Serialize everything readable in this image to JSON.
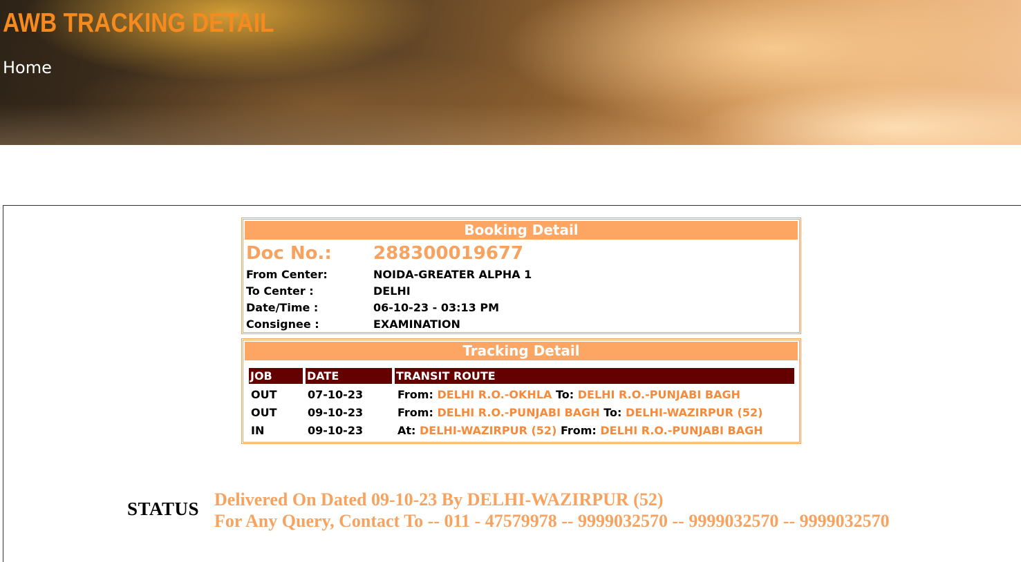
{
  "banner": {
    "title": "AWB TRACKING DETAIL",
    "breadcrumb": "Home"
  },
  "booking": {
    "header": "Booking Detail",
    "doc_label": "Doc No.:",
    "doc_value": "288300019677",
    "rows": [
      {
        "label": "From Center:",
        "value": "NOIDA-GREATER ALPHA 1"
      },
      {
        "label": "To Center :",
        "value": "DELHI"
      },
      {
        "label": "Date/Time :",
        "value": "06-10-23 - 03:13 PM"
      },
      {
        "label": "Consignee :",
        "value": "EXAMINATION"
      }
    ]
  },
  "tracking": {
    "header": "Tracking Detail",
    "columns": [
      "JOB",
      "DATE",
      "TRANSIT ROUTE"
    ],
    "rows": [
      {
        "job": "OUT",
        "date": "07-10-23",
        "kw1": "From:",
        "loc1": "DELHI R.O.-OKHLA",
        "kw2": "To:",
        "loc2": "DELHI R.O.-PUNJABI BAGH"
      },
      {
        "job": "OUT",
        "date": "09-10-23",
        "kw1": "From:",
        "loc1": "DELHI R.O.-PUNJABI BAGH",
        "kw2": "To:",
        "loc2": "DELHI-WAZIRPUR (52)"
      },
      {
        "job": "IN",
        "date": "09-10-23",
        "kw1": "At:",
        "loc1": "DELHI-WAZIRPUR (52)",
        "kw2": "From:",
        "loc2": "DELHI R.O.-PUNJABI BAGH"
      }
    ]
  },
  "status": {
    "label": "STATUS",
    "line1": "Delivered On Dated 09-10-23 By DELHI-WAZIRPUR (52)",
    "line2": "For Any Query, Contact To -- 011 - 47579978 -- 9999032570 -- 9999032570 -- 9999032570"
  },
  "colors": {
    "title_orange": "#f58a1f",
    "panel_header": "#fda562",
    "table_header": "#650000",
    "location_text": "#f58a3a",
    "status_text": "#f7a35f"
  }
}
